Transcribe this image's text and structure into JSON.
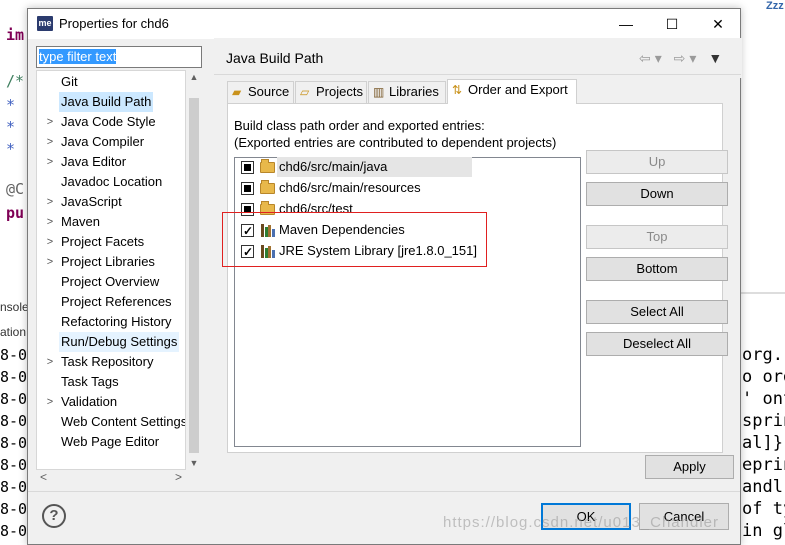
{
  "background": {
    "left_code": [
      "im",
      "/*",
      "*",
      "*",
      "*",
      "@C",
      "pu"
    ],
    "console_tabs": [
      "nsole",
      "ation"
    ],
    "console_lines": [
      "8-0",
      "8-0",
      "8-0",
      "8-0",
      "8-0",
      "8-0",
      "8-0",
      "8-0",
      "8-0"
    ],
    "right_code": [
      "org.",
      "o org",
      "' ont",
      "sprin",
      "al]}\"",
      "eprin",
      "andl",
      "of ty",
      "in gl"
    ],
    "right_top": "Zzz"
  },
  "dialog": {
    "title": "Properties for chd6",
    "app_icon_text": "me",
    "window_buttons": {
      "minimize": "—",
      "maximize": "☐",
      "close": "✕"
    }
  },
  "filter": {
    "value": "type filter text"
  },
  "tree": {
    "items": [
      {
        "label": "Git",
        "arrow": ""
      },
      {
        "label": "Java Build Path",
        "arrow": "",
        "selected": true
      },
      {
        "label": "Java Code Style",
        "arrow": ">"
      },
      {
        "label": "Java Compiler",
        "arrow": ">"
      },
      {
        "label": "Java Editor",
        "arrow": ">"
      },
      {
        "label": "Javadoc Location",
        "arrow": ""
      },
      {
        "label": "JavaScript",
        "arrow": ">"
      },
      {
        "label": "Maven",
        "arrow": ">"
      },
      {
        "label": "Project Facets",
        "arrow": ">"
      },
      {
        "label": "Project Libraries",
        "arrow": ">"
      },
      {
        "label": "Project Overview",
        "arrow": ""
      },
      {
        "label": "Project References",
        "arrow": ""
      },
      {
        "label": "Refactoring History",
        "arrow": ""
      },
      {
        "label": "Run/Debug Settings",
        "arrow": "",
        "hover": true
      },
      {
        "label": "Task Repository",
        "arrow": ">"
      },
      {
        "label": "Task Tags",
        "arrow": ""
      },
      {
        "label": "Validation",
        "arrow": ">"
      },
      {
        "label": "Web Content Settings",
        "arrow": ""
      },
      {
        "label": "Web Page Editor",
        "arrow": ""
      }
    ]
  },
  "page": {
    "title": "Java Build Path",
    "tabs": [
      {
        "label": "Source",
        "icon": "source-folder-icon"
      },
      {
        "label": "Projects",
        "icon": "projects-icon"
      },
      {
        "label": "Libraries",
        "icon": "libraries-icon"
      },
      {
        "label": "Order and Export",
        "icon": "order-export-icon",
        "active": true
      }
    ],
    "description_line1": "Build class path order and exported entries:",
    "description_line2": "(Exported entries are contributed to dependent projects)",
    "entries": [
      {
        "label": "chd6/src/main/java",
        "state": "partial",
        "icon": "folder",
        "selected": true
      },
      {
        "label": "chd6/src/main/resources",
        "state": "partial",
        "icon": "folder"
      },
      {
        "label": "chd6/src/test",
        "state": "partial",
        "icon": "folder"
      },
      {
        "label": "Maven Dependencies",
        "state": "checked",
        "icon": "library"
      },
      {
        "label": "JRE System Library [jre1.8.0_151]",
        "state": "checked",
        "icon": "library"
      }
    ],
    "buttons": {
      "up": "Up",
      "down": "Down",
      "top": "Top",
      "bottom": "Bottom",
      "select_all": "Select All",
      "deselect_all": "Deselect All"
    },
    "apply": "Apply"
  },
  "footer": {
    "help": "?",
    "ok": "OK",
    "cancel": "Cancel"
  },
  "watermark": "https://blog.csdn.net/u013_Chandler"
}
